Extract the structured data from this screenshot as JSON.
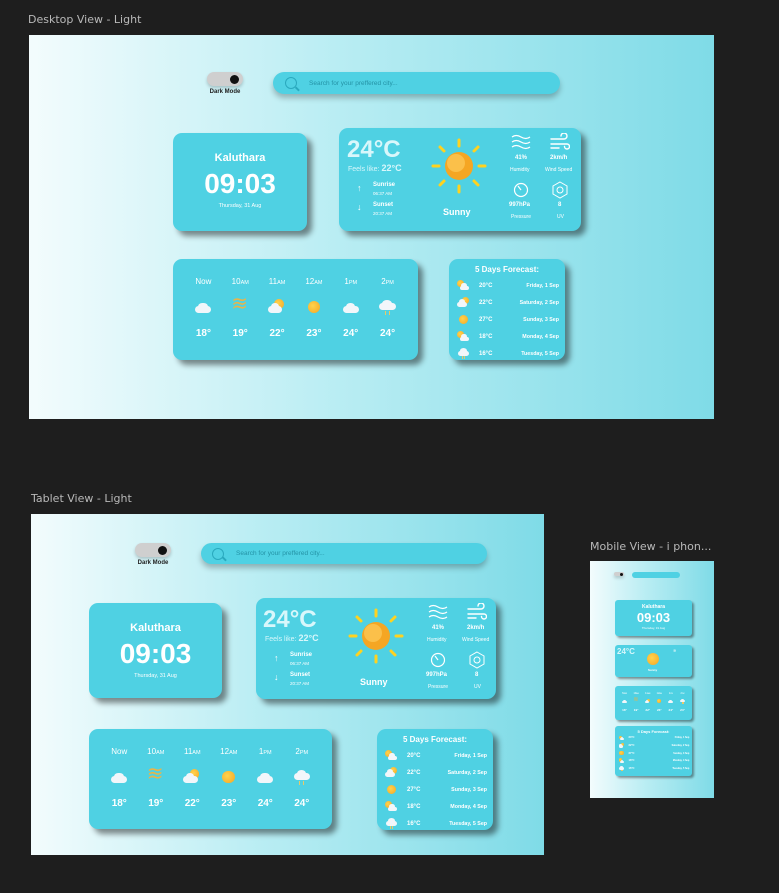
{
  "frames": {
    "desktop_label": "Desktop View - Light",
    "tablet_label": "Tablet View - Light",
    "mobile_label": "Mobile View - i phon..."
  },
  "toggle": {
    "label": "Dark Mode"
  },
  "search": {
    "placeholder": "Search for your preffered city..."
  },
  "city": {
    "name": "Kaluthara",
    "time": "09:03",
    "date": "Thursday, 31 Aug"
  },
  "current": {
    "temp": "24°C",
    "feels_label": "Feels like:",
    "feels_value": "22°C",
    "sunrise_label": "Sunrise",
    "sunrise_time": "06:37 AM",
    "sunset_label": "Sunset",
    "sunset_time": "20:37 AM",
    "condition": "Sunny",
    "humidity_value": "41%",
    "humidity_label": "Humidity",
    "wind_value": "2km/h",
    "wind_label": "Wind Speed",
    "pressure_value": "997hPa",
    "pressure_label": "Pressure",
    "uv_value": "8",
    "uv_label": "UV"
  },
  "hourly": [
    {
      "time": "Now",
      "suffix": "",
      "icon": "cloud-icon",
      "temp": "18°"
    },
    {
      "time": "10",
      "suffix": "AM",
      "icon": "wind-icon",
      "temp": "19°"
    },
    {
      "time": "11",
      "suffix": "AM",
      "icon": "partly-cloudy-icon",
      "temp": "22°"
    },
    {
      "time": "12",
      "suffix": "AM",
      "icon": "sun-icon",
      "temp": "23°"
    },
    {
      "time": "1",
      "suffix": "PM",
      "icon": "cloud-icon",
      "temp": "24°"
    },
    {
      "time": "2",
      "suffix": "PM",
      "icon": "rain-cloud-icon",
      "temp": "24°"
    }
  ],
  "forecast": {
    "title": "5 Days Forecast:",
    "days": [
      {
        "icon": "sun-cloud-icon",
        "temp": "20°C",
        "day": "Friday, 1 Sep"
      },
      {
        "icon": "cloud-sun-icon",
        "temp": "22°C",
        "day": "Saturday, 2 Sep"
      },
      {
        "icon": "sun-icon",
        "temp": "27°C",
        "day": "Sunday, 3 Sep"
      },
      {
        "icon": "sun-cloud-icon",
        "temp": "18°C",
        "day": "Monday, 4 Sep"
      },
      {
        "icon": "rain-cloud-icon",
        "temp": "16°C",
        "day": "Tuesday, 5 Sep"
      }
    ]
  },
  "colors": {
    "card": "#4fd1e3",
    "frame_left": "#f3fcfd",
    "frame_right": "#7fdbe7",
    "sun": "#f5a623"
  }
}
